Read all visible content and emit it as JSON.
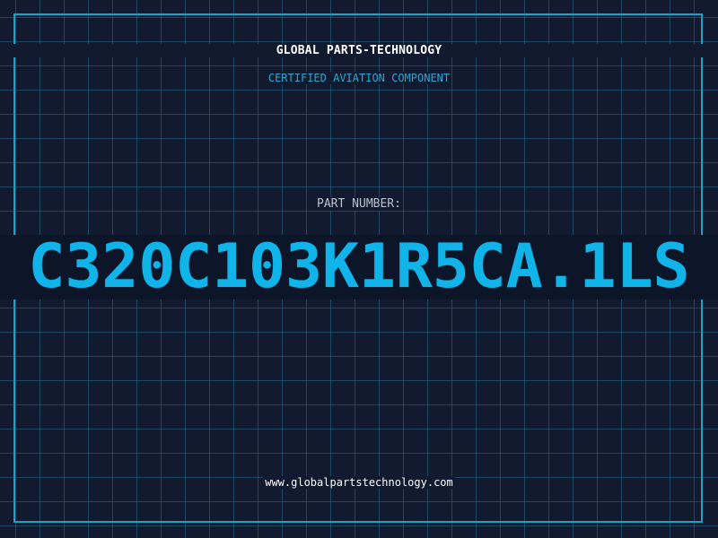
{
  "header": {
    "company": "GLOBAL PARTS-TECHNOLOGY",
    "tagline": "CERTIFIED AVIATION COMPONENT"
  },
  "part": {
    "label": "PART NUMBER:",
    "number": "C320C103K1R5CA.1LS"
  },
  "footer": {
    "url": "www.globalpartstechnology.com"
  },
  "colors": {
    "background": "#111a2e",
    "grid": "#286e8c",
    "accent": "#1aa3c8",
    "part_number": "#11b4e8",
    "text": "#ffffff"
  }
}
